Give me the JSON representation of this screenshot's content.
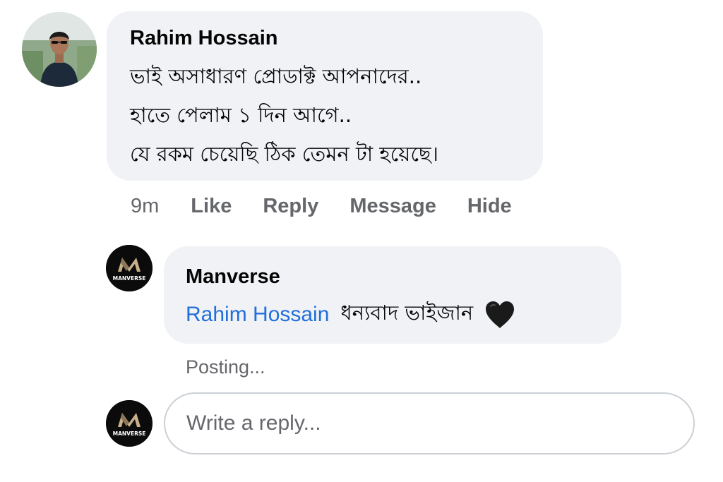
{
  "comment": {
    "author": "Rahim Hossain",
    "lines": [
      "ভাই অসাধারণ  প্রোডাক্ট আপনাদের..",
      "হাতে পেলাম ১ দিন আগে..",
      "যে রকম চেয়েছি ঠিক  তেমন টা হয়েছে।"
    ],
    "time": "9m",
    "actions": {
      "like": "Like",
      "reply": "Reply",
      "message": "Message",
      "hide": "Hide"
    }
  },
  "reply": {
    "author": "Manverse",
    "mention": "Rahim Hossain",
    "text": "ধন্যবাদ ভাইজান",
    "emoji_icon": "black-heart-icon",
    "status": "Posting..."
  },
  "brand": {
    "logo_text": "MANVERSE",
    "logo_mark": "M"
  },
  "composer": {
    "placeholder": "Write a reply..."
  },
  "colors": {
    "bubble": "#f0f2f5",
    "mention": "#216fdb",
    "muted": "#65676b",
    "text": "#050505"
  }
}
